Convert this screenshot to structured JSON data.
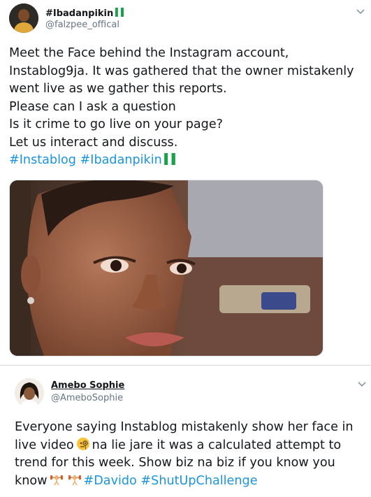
{
  "colors": {
    "link": "#1b95e0",
    "secondary_text": "#657786",
    "text": "#14171a",
    "divider": "#d5dade"
  },
  "tweet1": {
    "display_name": "#Ibadanpikin",
    "handle": "@falzpee_offical",
    "lines": [
      "Meet the Face behind the Instagram account,",
      "Instablog9ja. It was gathered that the owner mistakenly",
      "went live as we gather this reports.",
      "Please can I ask a question",
      "Is it crime to go live on your page?",
      "Let us interact and discuss."
    ],
    "hashtags": [
      "#Instablog",
      "#Ibadanpikin"
    ],
    "icons": {
      "menu": "chevron-down-icon",
      "flag": "nigeria-flag-icon"
    }
  },
  "tweet2": {
    "display_name": "Amebo Sophie",
    "handle": "@AmeboSophie",
    "line1": "Everyone saying Instablog mistakenly show her face in",
    "line2_a": "live video",
    "line2_b": "na lie jare it was a calculated attempt to",
    "line3": "trend for this week. Show biz na biz if you know you",
    "line4_a": "know",
    "hashtags": [
      "#Davido",
      "#ShutUpChallenge"
    ],
    "icons": {
      "menu": "chevron-down-icon",
      "emoji1": "face-with-monocle-icon",
      "emoji2": "person-lifting-weights-icon"
    }
  }
}
